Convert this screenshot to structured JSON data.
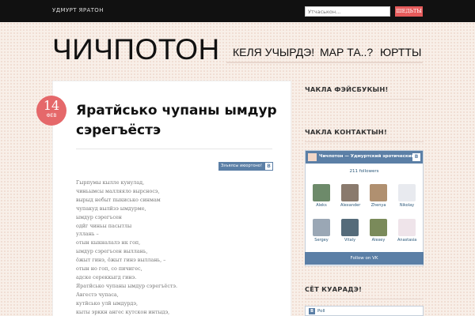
{
  "topbar": {
    "site_link": "УДМУРТ ЯРАТОН",
    "search_placeholder": "Утчаськон...",
    "search_button": "ШЕДЬТЫ"
  },
  "header": {
    "logo": "ЧИЧПОТОН",
    "nav": [
      "КЕЛЯ УЧЫРДЭ!",
      "МАР ТА..?",
      "ЮРТТЫ"
    ]
  },
  "post": {
    "date_day": "14",
    "date_month": "ФЕВ",
    "title": "Яратйсько чупаны ымдур сэрегъёстэ",
    "share_label": "Зэъялсы июортоно!",
    "share_icon": "vk-icon",
    "poem_lines": [
      "Гырпумы кылле кунулад,",
      "чиньымсы малляяло вырсно­сэ,",
      "вырыд небыт пыкисько синмам",
      "чупакуд вылйзэ ымдурме,",
      "ымдур сэрегъсен",
      "одйг чиньы пасытлы",
      "уллань –",
      "отын кыкналалэ нк гоп,",
      "ымдур сэрегъсен выллань,",
      "ӧжыт гинэ, ӧжыт гинэ выллань, –",
      "отын но гоп, со пичигес,",
      "адске сереккыгд гинэ.",
      "Яратйсько чупаны ымдур сэрегъёстэ.",
      "Авгестэ чупаса,",
      "кутйсько улй ымдурдэ,",
      "кыты эрккн ангес кутскон интыдэ,",
      "чыпты кутскоысь кыкеш небыт"
    ]
  },
  "sidebar": {
    "facebook_title": "ЧАКЛА ФЭЙСБУКЫН!",
    "vk_title": "ЧАКЛА КОНТАКТЫН!",
    "vk_widget": {
      "group_name": "Чичпотон — Удмуртский эротический",
      "logo_letter": "B",
      "followers": "211 followers",
      "members": [
        "Aleks",
        "Alexander",
        "Zhenya",
        "Nikolay",
        "Sergey",
        "Vitaly",
        "Alexey",
        "Anastasia"
      ],
      "member_colors": [
        "#6d8a6a",
        "#8a7a6d",
        "#b09070",
        "#e8eaef",
        "#9aa7b5",
        "#556b7a",
        "#7a8a5a",
        "#efe4ea"
      ],
      "follow_button": "Follow on VK"
    },
    "connect_title": "СЁТ КУАРАДЭ!",
    "poll_letter": "B",
    "poll_label": "Poll"
  }
}
